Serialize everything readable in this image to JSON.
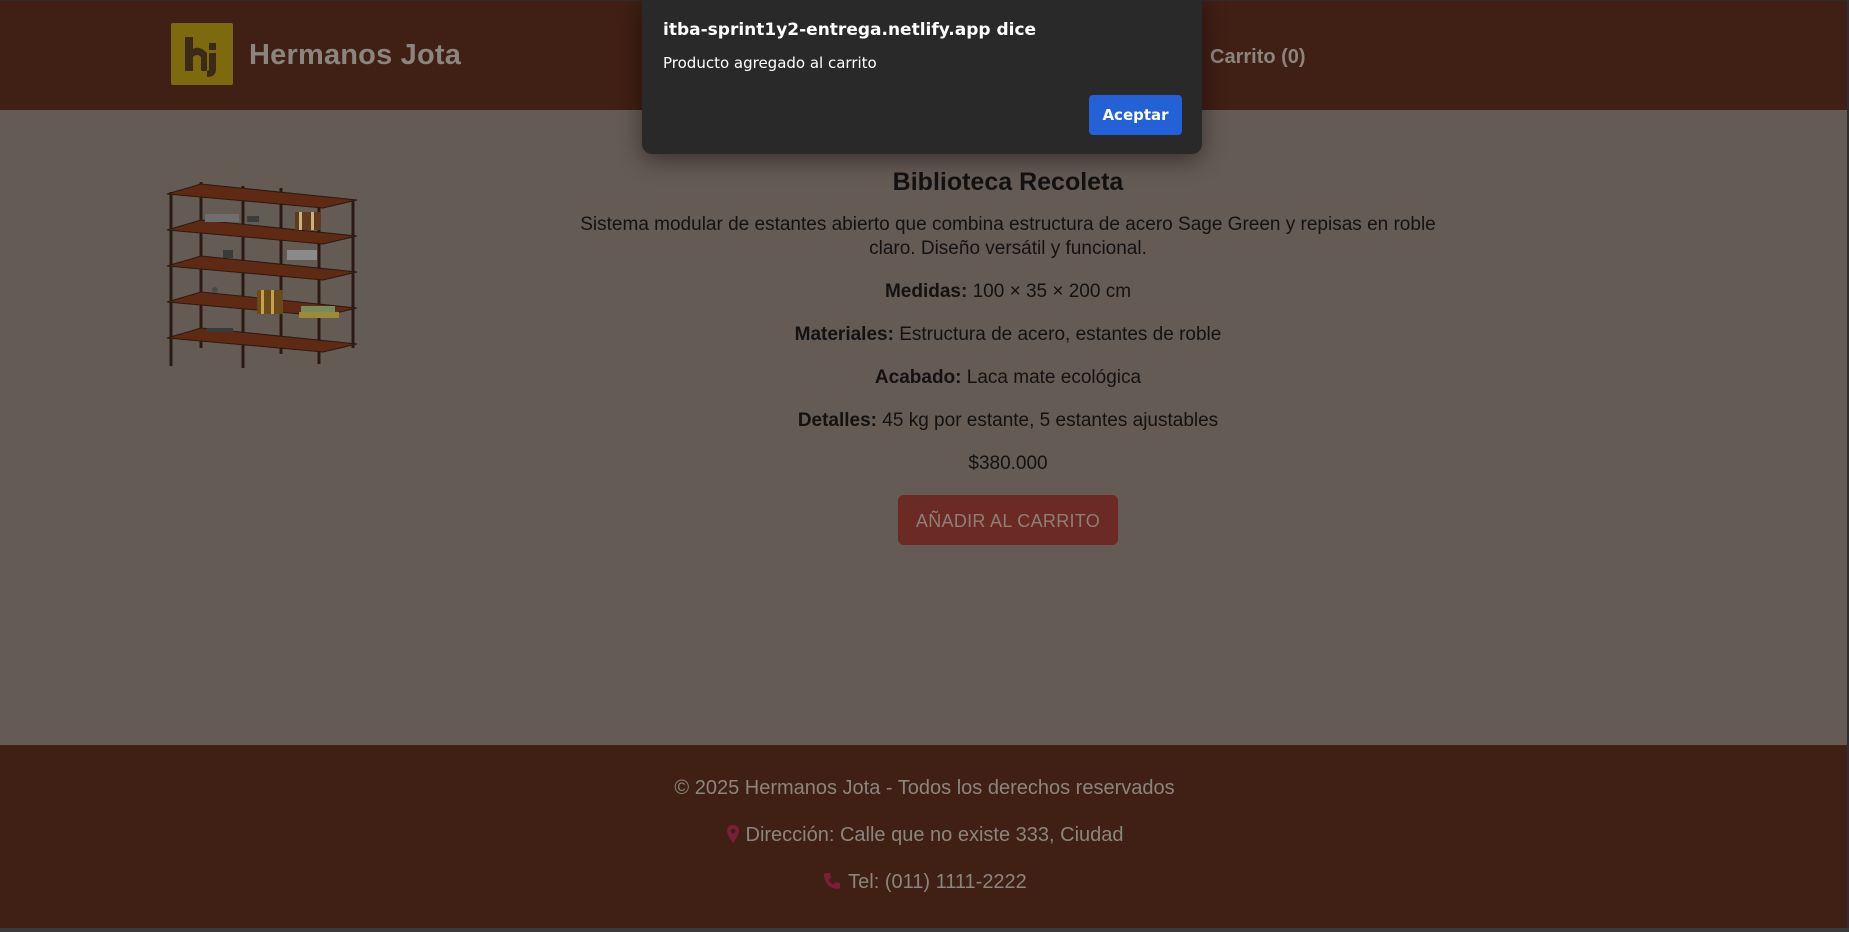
{
  "header": {
    "brand_name": "Hermanos Jota",
    "logo_icon": "hj-monogram-logo",
    "cart_label": "Carrito (0)"
  },
  "product": {
    "title": "Biblioteca Recoleta",
    "description": "Sistema modular de estantes abierto que combina estructura de acero Sage Green y repisas en roble claro. Diseño versátil y funcional.",
    "specs": [
      {
        "label": "Medidas:",
        "value": "100 × 35 × 200 cm"
      },
      {
        "label": "Materiales:",
        "value": "Estructura de acero, estantes de roble"
      },
      {
        "label": "Acabado:",
        "value": "Laca mate ecológica"
      },
      {
        "label": "Detalles:",
        "value": "45 kg por estante, 5 estantes ajustables"
      }
    ],
    "price": "$380.000",
    "add_to_cart_label": "AÑADIR AL CARRITO"
  },
  "footer": {
    "copyright": "© 2025 Hermanos Jota - Todos los derechos reservados",
    "address": "Dirección: Calle que no existe 333, Ciudad",
    "phone": "Tel: (011) 1111-2222"
  },
  "dialog": {
    "title": "itba-sprint1y2-entrega.netlify.app dice",
    "message": "Producto agregado al carrito",
    "ok_label": "Aceptar"
  },
  "colors": {
    "header_bg": "#401f14",
    "overlay_body_bg": "#655b55",
    "logo_gold": "#7d6a0e",
    "button_dimmed": "#6b2a24",
    "dialog_bg": "#292929",
    "dialog_button": "#2461d6"
  }
}
